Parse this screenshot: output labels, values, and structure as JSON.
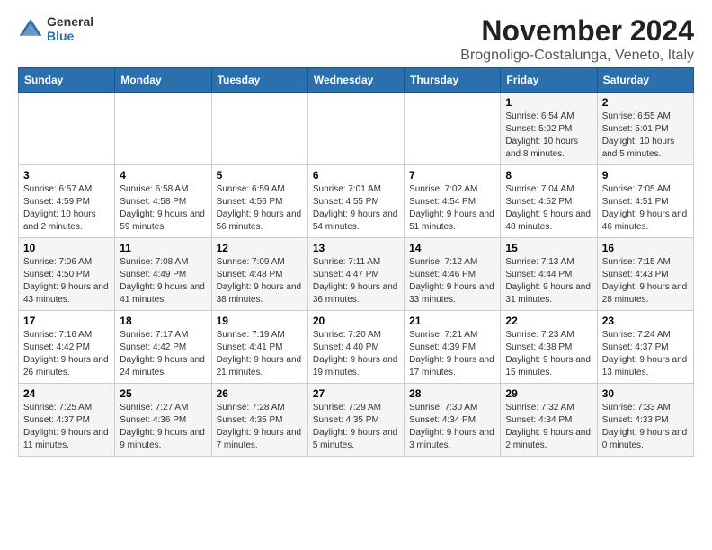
{
  "header": {
    "month_title": "November 2024",
    "subtitle": "Brognoligo-Costalunga, Veneto, Italy",
    "logo_general": "General",
    "logo_blue": "Blue"
  },
  "columns": [
    "Sunday",
    "Monday",
    "Tuesday",
    "Wednesday",
    "Thursday",
    "Friday",
    "Saturday"
  ],
  "weeks": [
    [
      {
        "day": "",
        "detail": ""
      },
      {
        "day": "",
        "detail": ""
      },
      {
        "day": "",
        "detail": ""
      },
      {
        "day": "",
        "detail": ""
      },
      {
        "day": "",
        "detail": ""
      },
      {
        "day": "1",
        "detail": "Sunrise: 6:54 AM\nSunset: 5:02 PM\nDaylight: 10 hours and 8 minutes."
      },
      {
        "day": "2",
        "detail": "Sunrise: 6:55 AM\nSunset: 5:01 PM\nDaylight: 10 hours and 5 minutes."
      }
    ],
    [
      {
        "day": "3",
        "detail": "Sunrise: 6:57 AM\nSunset: 4:59 PM\nDaylight: 10 hours and 2 minutes."
      },
      {
        "day": "4",
        "detail": "Sunrise: 6:58 AM\nSunset: 4:58 PM\nDaylight: 9 hours and 59 minutes."
      },
      {
        "day": "5",
        "detail": "Sunrise: 6:59 AM\nSunset: 4:56 PM\nDaylight: 9 hours and 56 minutes."
      },
      {
        "day": "6",
        "detail": "Sunrise: 7:01 AM\nSunset: 4:55 PM\nDaylight: 9 hours and 54 minutes."
      },
      {
        "day": "7",
        "detail": "Sunrise: 7:02 AM\nSunset: 4:54 PM\nDaylight: 9 hours and 51 minutes."
      },
      {
        "day": "8",
        "detail": "Sunrise: 7:04 AM\nSunset: 4:52 PM\nDaylight: 9 hours and 48 minutes."
      },
      {
        "day": "9",
        "detail": "Sunrise: 7:05 AM\nSunset: 4:51 PM\nDaylight: 9 hours and 46 minutes."
      }
    ],
    [
      {
        "day": "10",
        "detail": "Sunrise: 7:06 AM\nSunset: 4:50 PM\nDaylight: 9 hours and 43 minutes."
      },
      {
        "day": "11",
        "detail": "Sunrise: 7:08 AM\nSunset: 4:49 PM\nDaylight: 9 hours and 41 minutes."
      },
      {
        "day": "12",
        "detail": "Sunrise: 7:09 AM\nSunset: 4:48 PM\nDaylight: 9 hours and 38 minutes."
      },
      {
        "day": "13",
        "detail": "Sunrise: 7:11 AM\nSunset: 4:47 PM\nDaylight: 9 hours and 36 minutes."
      },
      {
        "day": "14",
        "detail": "Sunrise: 7:12 AM\nSunset: 4:46 PM\nDaylight: 9 hours and 33 minutes."
      },
      {
        "day": "15",
        "detail": "Sunrise: 7:13 AM\nSunset: 4:44 PM\nDaylight: 9 hours and 31 minutes."
      },
      {
        "day": "16",
        "detail": "Sunrise: 7:15 AM\nSunset: 4:43 PM\nDaylight: 9 hours and 28 minutes."
      }
    ],
    [
      {
        "day": "17",
        "detail": "Sunrise: 7:16 AM\nSunset: 4:42 PM\nDaylight: 9 hours and 26 minutes."
      },
      {
        "day": "18",
        "detail": "Sunrise: 7:17 AM\nSunset: 4:42 PM\nDaylight: 9 hours and 24 minutes."
      },
      {
        "day": "19",
        "detail": "Sunrise: 7:19 AM\nSunset: 4:41 PM\nDaylight: 9 hours and 21 minutes."
      },
      {
        "day": "20",
        "detail": "Sunrise: 7:20 AM\nSunset: 4:40 PM\nDaylight: 9 hours and 19 minutes."
      },
      {
        "day": "21",
        "detail": "Sunrise: 7:21 AM\nSunset: 4:39 PM\nDaylight: 9 hours and 17 minutes."
      },
      {
        "day": "22",
        "detail": "Sunrise: 7:23 AM\nSunset: 4:38 PM\nDaylight: 9 hours and 15 minutes."
      },
      {
        "day": "23",
        "detail": "Sunrise: 7:24 AM\nSunset: 4:37 PM\nDaylight: 9 hours and 13 minutes."
      }
    ],
    [
      {
        "day": "24",
        "detail": "Sunrise: 7:25 AM\nSunset: 4:37 PM\nDaylight: 9 hours and 11 minutes."
      },
      {
        "day": "25",
        "detail": "Sunrise: 7:27 AM\nSunset: 4:36 PM\nDaylight: 9 hours and 9 minutes."
      },
      {
        "day": "26",
        "detail": "Sunrise: 7:28 AM\nSunset: 4:35 PM\nDaylight: 9 hours and 7 minutes."
      },
      {
        "day": "27",
        "detail": "Sunrise: 7:29 AM\nSunset: 4:35 PM\nDaylight: 9 hours and 5 minutes."
      },
      {
        "day": "28",
        "detail": "Sunrise: 7:30 AM\nSunset: 4:34 PM\nDaylight: 9 hours and 3 minutes."
      },
      {
        "day": "29",
        "detail": "Sunrise: 7:32 AM\nSunset: 4:34 PM\nDaylight: 9 hours and 2 minutes."
      },
      {
        "day": "30",
        "detail": "Sunrise: 7:33 AM\nSunset: 4:33 PM\nDaylight: 9 hours and 0 minutes."
      }
    ]
  ]
}
